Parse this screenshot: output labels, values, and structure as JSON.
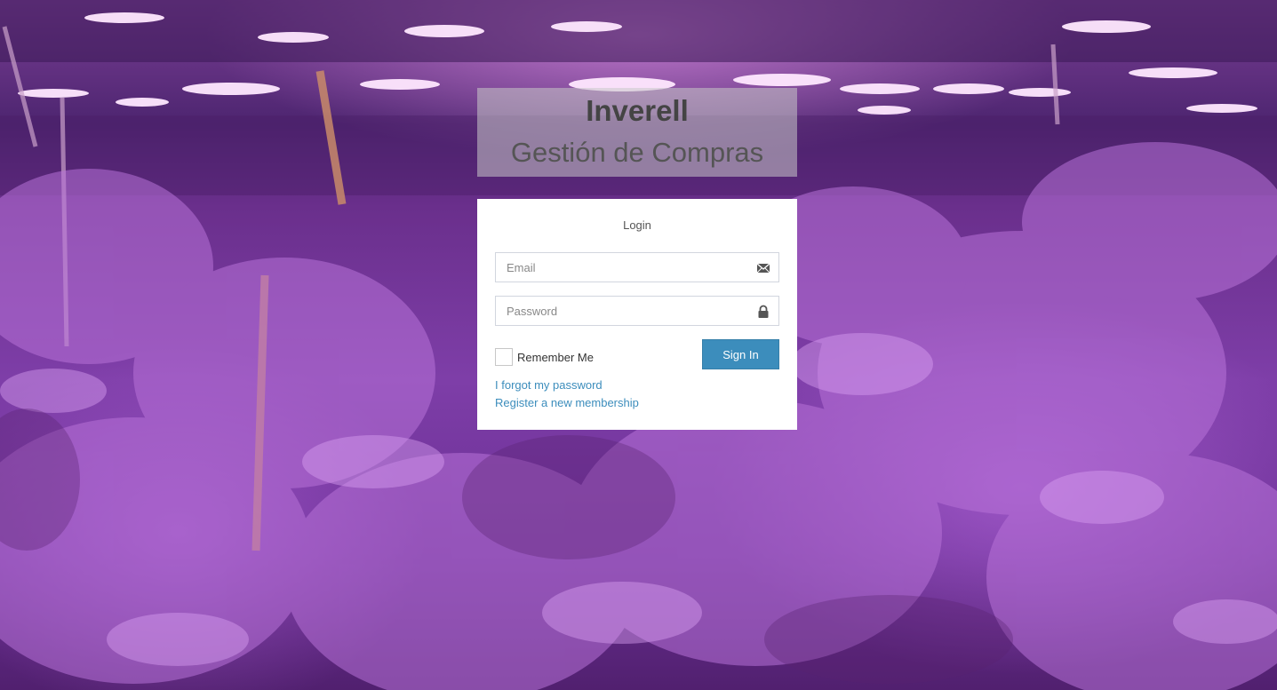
{
  "brand": {
    "title": "Inverell",
    "subtitle": "Gestión de Compras"
  },
  "login": {
    "message": "Login",
    "email_placeholder": "Email",
    "password_placeholder": "Password",
    "remember_label": "Remember Me",
    "signin_label": "Sign In",
    "forgot_link": "I forgot my password",
    "register_link": "Register a new membership"
  },
  "icons": {
    "email": "envelope-icon",
    "password": "lock-icon"
  },
  "colors": {
    "primary_button": "#3c8dbc",
    "link": "#3c8dbc",
    "brand_text": "#444444"
  }
}
